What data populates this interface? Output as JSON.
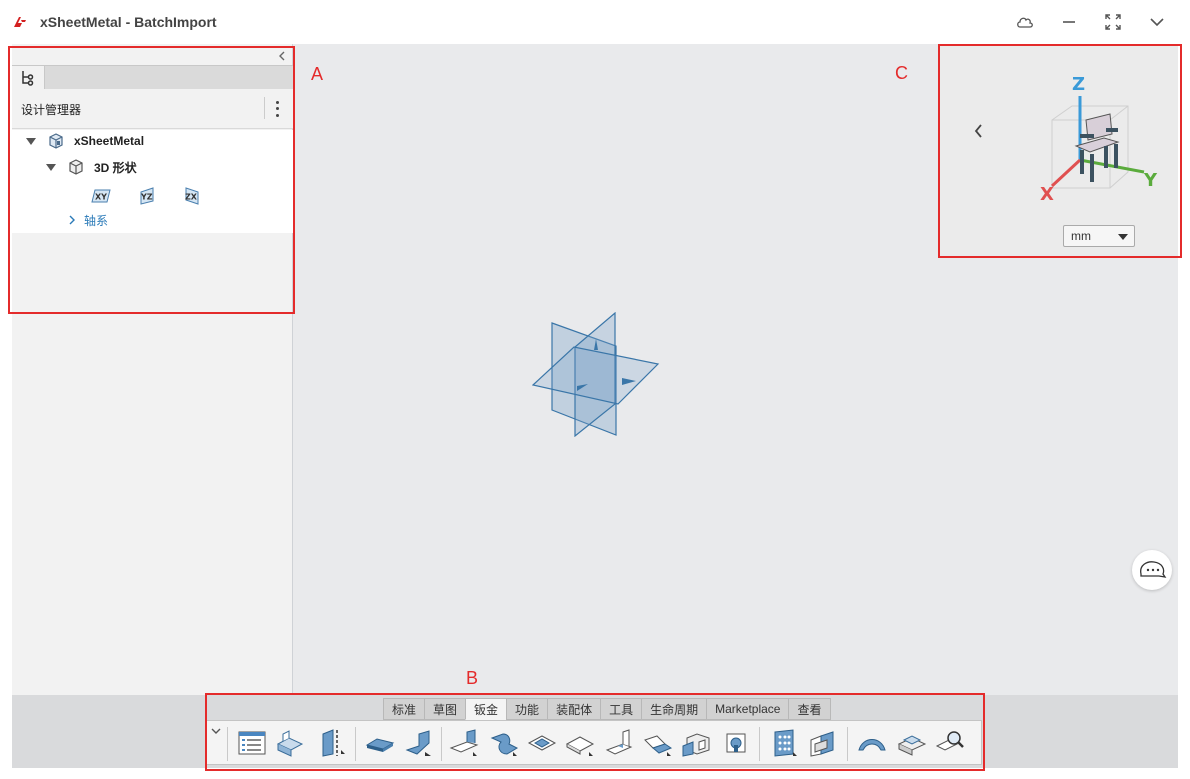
{
  "app": {
    "title": "xSheetMetal - BatchImport"
  },
  "design_manager": {
    "title": "设计管理器",
    "tree": [
      {
        "label": "xSheetMetal",
        "icon": "part-icon"
      },
      {
        "label": "3D 形状",
        "icon": "shape-icon"
      }
    ],
    "planes": [
      "XY",
      "YZ",
      "ZX"
    ],
    "axis_item": "轴系"
  },
  "view_panel": {
    "units": "mm",
    "axes": [
      "X",
      "Y",
      "Z"
    ]
  },
  "command_tabs": [
    "标准",
    "草图",
    "钣金",
    "功能",
    "装配体",
    "工具",
    "生命周期",
    "Marketplace",
    "查看"
  ],
  "active_tab": "钣金",
  "annotations": [
    "A",
    "B",
    "C"
  ],
  "colors": {
    "accent": "#2a7ab8",
    "annotation": "#e42b2b",
    "axis_x": "#e05050",
    "axis_y": "#5aab3c",
    "axis_z": "#3a9ad8"
  }
}
